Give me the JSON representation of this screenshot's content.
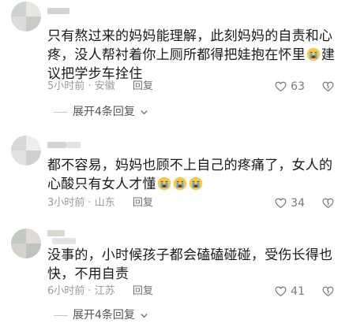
{
  "comments": [
    {
      "text_parts": [
        "只有熬过来的妈妈能理解，此刻妈妈的自责和心疼，没人帮衬着你上厕所都得把娃抱在怀里",
        "建议把学步车拴住"
      ],
      "time": "5小时前",
      "location": "安徽",
      "reply_label": "回复",
      "likes": "63",
      "expand_label": "展开4条回复"
    },
    {
      "text_parts": [
        "都不容易，妈妈也顾不上自己的疼痛了，女人的心酸只有女人才懂"
      ],
      "time": "3小时前",
      "location": "山东",
      "reply_label": "回复",
      "likes": "34"
    },
    {
      "text_parts": [
        "没事的，小时候孩子都会磕磕碰碰，受伤长得也快，不用自责"
      ],
      "time": "6小时前",
      "location": "江苏",
      "reply_label": "回复",
      "likes": "41",
      "expand_label": "展开4条回复"
    }
  ],
  "separator": "·",
  "icons": {
    "emoji": "crying-face-icon",
    "like": "heart-icon",
    "dislike": "broken-heart-icon",
    "expand": "chevron-down-icon"
  },
  "colors": {
    "emoji_face": "#f6c84c",
    "emoji_tear": "#5aa9e6",
    "meta": "#9a9a9a"
  }
}
